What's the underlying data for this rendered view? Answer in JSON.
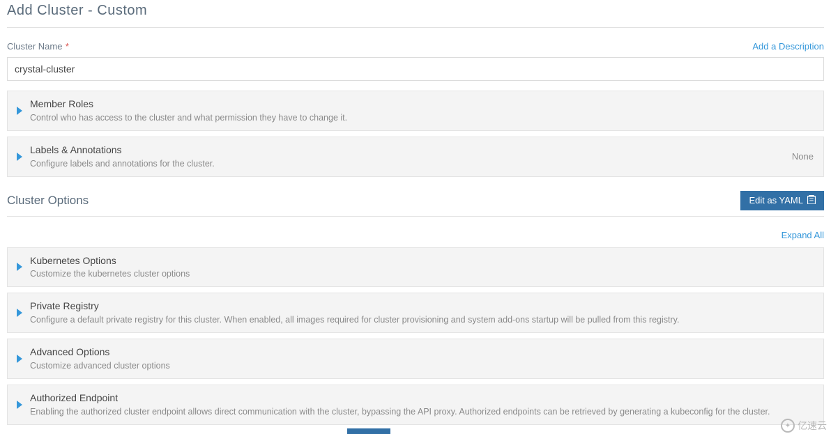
{
  "header": {
    "title": "Add Cluster - Custom"
  },
  "name_field": {
    "label": "Cluster Name",
    "required_mark": "*",
    "value": "crystal-cluster",
    "add_description_link": "Add a Description"
  },
  "expanders_top": [
    {
      "title": "Member Roles",
      "sub": "Control who has access to the cluster and what permission they have to change it.",
      "right": ""
    },
    {
      "title": "Labels & Annotations",
      "sub": "Configure labels and annotations for the cluster.",
      "right": "None"
    }
  ],
  "cluster_options": {
    "heading": "Cluster Options",
    "yaml_button": "Edit as YAML",
    "expand_all": "Expand All"
  },
  "expanders_bottom": [
    {
      "title": "Kubernetes Options",
      "sub": "Customize the kubernetes cluster options"
    },
    {
      "title": "Private Registry",
      "sub": "Configure a default private registry for this cluster. When enabled, all images required for cluster provisioning and system add-ons startup will be pulled from this registry."
    },
    {
      "title": "Advanced Options",
      "sub": "Customize advanced cluster options"
    },
    {
      "title": "Authorized Endpoint",
      "sub": "Enabling the authorized cluster endpoint allows direct communication with the cluster, bypassing the API proxy. Authorized endpoints can be retrieved by generating a kubeconfig for the cluster."
    }
  ],
  "watermark": "亿速云"
}
